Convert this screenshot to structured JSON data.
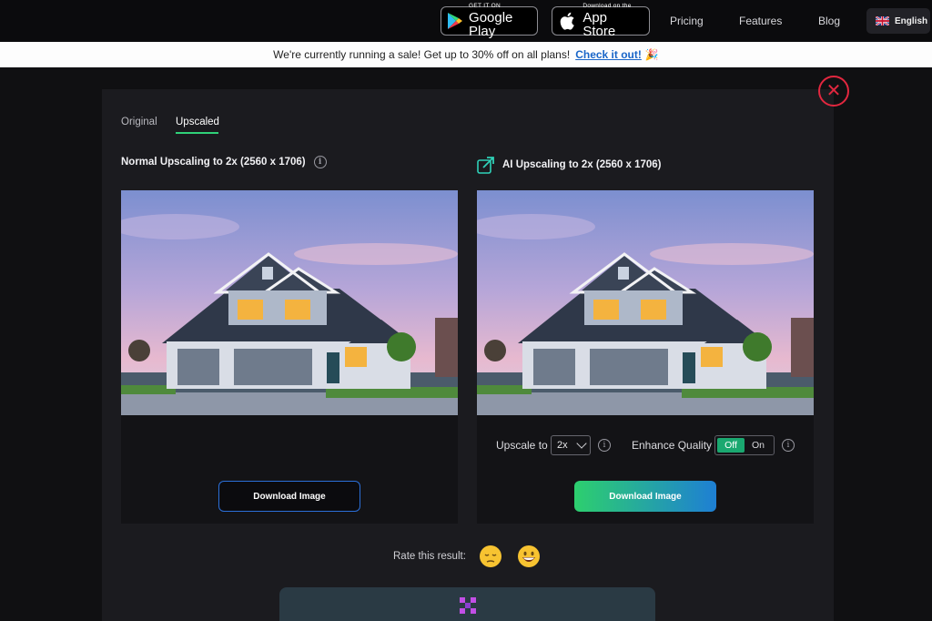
{
  "nav": {
    "google_play": {
      "small": "GET IT ON",
      "big": "Google Play"
    },
    "app_store": {
      "small": "Download on the",
      "big": "App Store"
    },
    "links": [
      "Pricing",
      "Features",
      "Blog"
    ],
    "language": "English"
  },
  "sale": {
    "text": "We're currently running a sale! Get up to 30% off on all plans!",
    "link": "Check it out!"
  },
  "tabs": [
    "Original",
    "Upscaled"
  ],
  "active_tab": "Upscaled",
  "left": {
    "title": "Normal Upscaling to 2x (2560 x 1706)",
    "download": "Download Image"
  },
  "right": {
    "title": "AI Upscaling to 2x (2560 x 1706)",
    "upscale_label": "Upscale to",
    "upscale_value": "2x",
    "enhance_label": "Enhance Quality",
    "toggle_off": "Off",
    "toggle_on": "On",
    "toggle_state": "Off",
    "download": "Download Image"
  },
  "rating": {
    "label": "Rate this result:"
  },
  "icons": {
    "close": "close-icon",
    "info": "info-icon",
    "ai": "ai-upscale-icon",
    "flag": "uk-flag-icon"
  },
  "colors": {
    "accent_green": "#2fd178",
    "close_red": "#e2273f",
    "link_blue": "#1a66c8",
    "download_gradient_start": "#2dcf6e",
    "download_gradient_end": "#1e7fd4"
  }
}
